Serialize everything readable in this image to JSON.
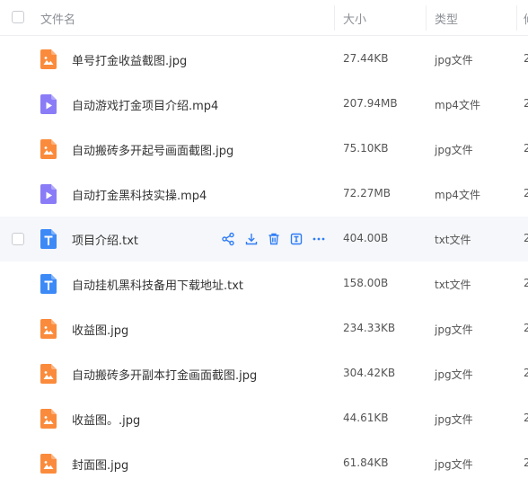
{
  "header": {
    "col_name": "文件名",
    "col_size": "大小",
    "col_type": "类型",
    "col_clip": "修"
  },
  "files": [
    {
      "name": "单号打金收益截图.jpg",
      "size": "27.44KB",
      "type": "jpg文件",
      "clip": "2",
      "icon": "image-file-icon"
    },
    {
      "name": "自动游戏打金项目介绍.mp4",
      "size": "207.94MB",
      "type": "mp4文件",
      "clip": "2",
      "icon": "video-file-icon"
    },
    {
      "name": "自动搬砖多开起号画面截图.jpg",
      "size": "75.10KB",
      "type": "jpg文件",
      "clip": "2",
      "icon": "image-file-icon"
    },
    {
      "name": "自动打金黑科技实操.mp4",
      "size": "72.27MB",
      "type": "mp4文件",
      "clip": "2",
      "icon": "video-file-icon"
    },
    {
      "name": "项目介绍.txt",
      "size": "404.00B",
      "type": "txt文件",
      "clip": "2",
      "icon": "text-file-icon"
    },
    {
      "name": "自动挂机黑科技备用下载地址.txt",
      "size": "158.00B",
      "type": "txt文件",
      "clip": "2",
      "icon": "text-file-icon"
    },
    {
      "name": "收益图.jpg",
      "size": "234.33KB",
      "type": "jpg文件",
      "clip": "2",
      "icon": "image-file-icon"
    },
    {
      "name": "自动搬砖多开副本打金画面截图.jpg",
      "size": "304.42KB",
      "type": "jpg文件",
      "clip": "2",
      "icon": "image-file-icon"
    },
    {
      "name": "收益图。.jpg",
      "size": "44.61KB",
      "type": "jpg文件",
      "clip": "2",
      "icon": "image-file-icon"
    },
    {
      "name": "封面图.jpg",
      "size": "61.84KB",
      "type": "jpg文件",
      "clip": "2",
      "icon": "image-file-icon"
    }
  ],
  "hover_actions": [
    "share-icon",
    "download-icon",
    "delete-icon",
    "rename-icon",
    "more-icon"
  ],
  "colors": {
    "image_icon": "#fb8b3c",
    "video_icon": "#8a7cf7",
    "text_icon": "#3d8af7",
    "action": "#2f7cf6",
    "hover_row": "#f5f7fa"
  }
}
